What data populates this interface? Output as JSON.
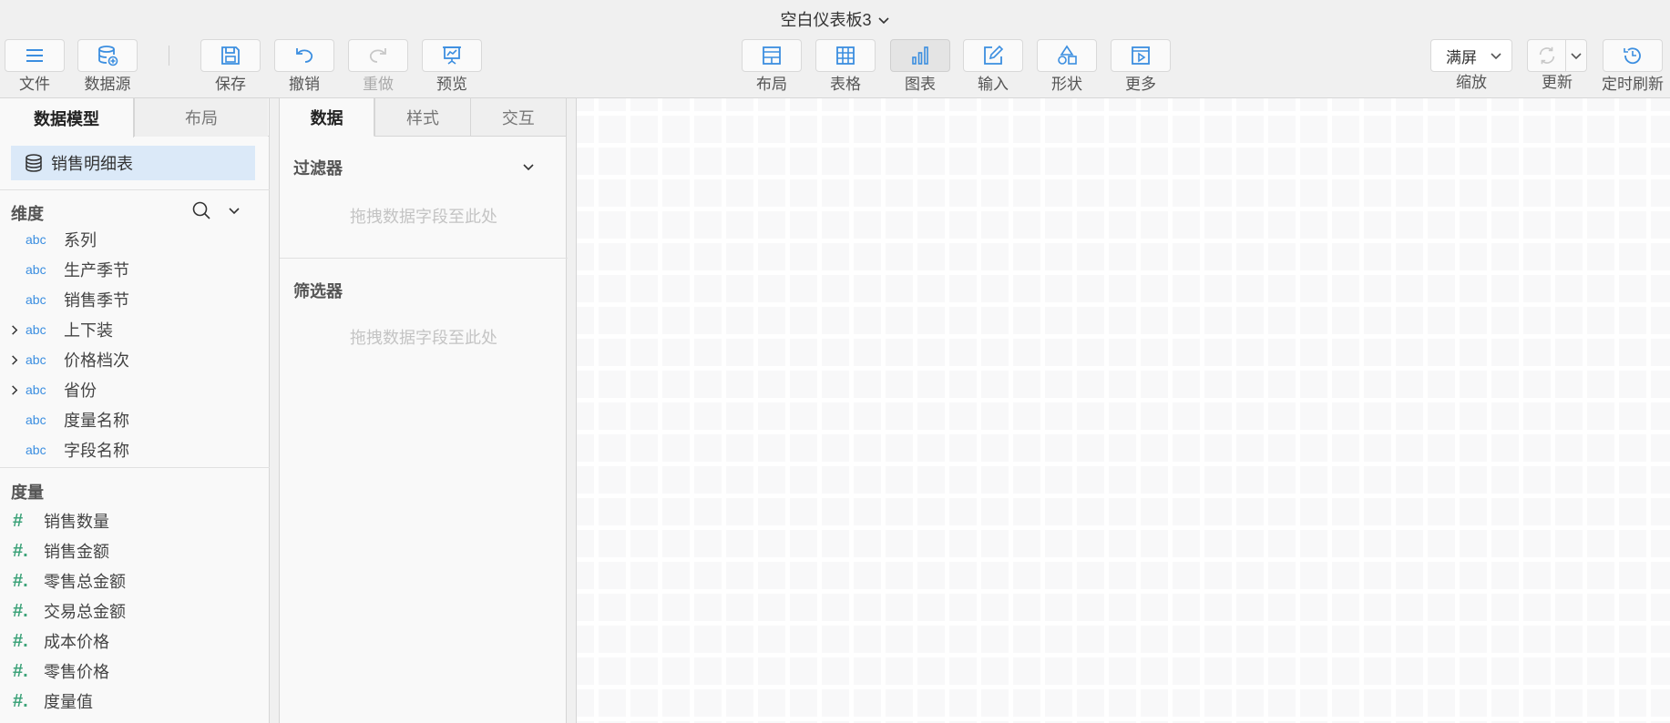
{
  "window": {
    "title": "空白仪表板3"
  },
  "toolbar": {
    "file": "文件",
    "datasource": "数据源",
    "save": "保存",
    "undo": "撤销",
    "redo": "重做",
    "preview": "预览",
    "layout": "布局",
    "table": "表格",
    "chart": "图表",
    "input": "输入",
    "shape": "形状",
    "more": "更多",
    "zoom_value": "满屏",
    "zoom_label": "缩放",
    "refresh": "更新",
    "timed_refresh": "定时刷新"
  },
  "left_panel": {
    "tabs": [
      "数据模型",
      "布局"
    ],
    "model": "销售明细表",
    "dimensions_title": "维度",
    "dimensions": [
      {
        "type": "abc",
        "name": "系列",
        "expandable": false
      },
      {
        "type": "abc",
        "name": "生产季节",
        "expandable": false
      },
      {
        "type": "abc",
        "name": "销售季节",
        "expandable": false
      },
      {
        "type": "abc",
        "name": "上下装",
        "expandable": true
      },
      {
        "type": "abc",
        "name": "价格档次",
        "expandable": true
      },
      {
        "type": "abc",
        "name": "省份",
        "expandable": true
      },
      {
        "type": "abc",
        "name": "度量名称",
        "expandable": false
      },
      {
        "type": "abc",
        "name": "字段名称",
        "expandable": false
      }
    ],
    "measures_title": "度量",
    "measures": [
      {
        "symbol": "#",
        "name": "销售数量"
      },
      {
        "symbol": "#.",
        "name": "销售金额"
      },
      {
        "symbol": "#.",
        "name": "零售总金额"
      },
      {
        "symbol": "#.",
        "name": "交易总金额"
      },
      {
        "symbol": "#.",
        "name": "成本价格"
      },
      {
        "symbol": "#.",
        "name": "零售价格"
      },
      {
        "symbol": "#.",
        "name": "度量值"
      }
    ]
  },
  "mid_panel": {
    "tabs": [
      "数据",
      "样式",
      "交互"
    ],
    "filter_title": "过滤器",
    "filter_hint": "拖拽数据字段至此处",
    "selector_title": "筛选器",
    "selector_hint": "拖拽数据字段至此处"
  },
  "colors": {
    "accent": "#3b8ee0",
    "measure": "#3ea37a",
    "selected_bg": "#dbe9f8"
  }
}
